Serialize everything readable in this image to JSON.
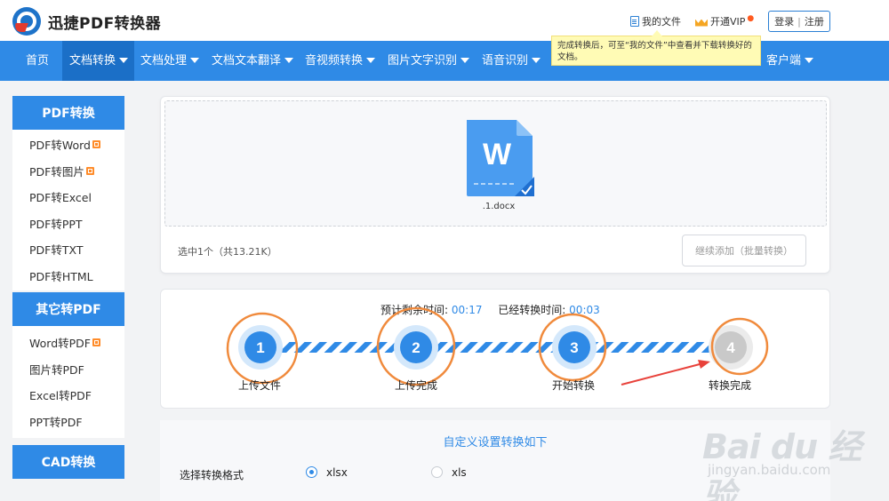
{
  "header": {
    "app_title": "迅捷PDF转换器",
    "my_files": "我的文件",
    "vip": "开通VIP",
    "login": "登录",
    "separator": "|",
    "register": "注册"
  },
  "nav": {
    "items": [
      {
        "label": "首页",
        "dropdown": false
      },
      {
        "label": "文档转换",
        "dropdown": true,
        "active": true
      },
      {
        "label": "文档处理",
        "dropdown": true
      },
      {
        "label": "文档文本翻译",
        "dropdown": true
      },
      {
        "label": "音视频转换",
        "dropdown": true
      },
      {
        "label": "图片文字识别",
        "dropdown": true
      },
      {
        "label": "语音识别",
        "dropdown": true
      },
      {
        "label": "客户端",
        "dropdown": true
      }
    ]
  },
  "tooltip": {
    "text": "完成转换后，可至“我的文件”中查看并下载转换好的文档。"
  },
  "sidebar": {
    "sections": [
      {
        "title": "PDF转换",
        "items": [
          {
            "label": "PDF转Word",
            "badge": true
          },
          {
            "label": "PDF转图片",
            "badge": true
          },
          {
            "label": "PDF转Excel",
            "badge": false
          },
          {
            "label": "PDF转PPT",
            "badge": false
          },
          {
            "label": "PDF转TXT",
            "badge": false
          },
          {
            "label": "PDF转HTML",
            "badge": false
          }
        ]
      },
      {
        "title": "其它转PDF",
        "items": [
          {
            "label": "Word转PDF",
            "badge": true
          },
          {
            "label": "图片转PDF",
            "badge": false
          },
          {
            "label": "Excel转PDF",
            "badge": false
          },
          {
            "label": "PPT转PDF",
            "badge": false
          }
        ]
      },
      {
        "title": "CAD转换",
        "items": []
      }
    ]
  },
  "upload": {
    "file_icon_letter": "W",
    "file_name": ".1.docx",
    "selected_info": "选中1个（共13.21K）",
    "continue_button": "继续添加（批量转换）"
  },
  "progress": {
    "remaining_label": "预计剩余时间:",
    "remaining_value": "00:17",
    "elapsed_label": "已经转换时间:",
    "elapsed_value": "00:03",
    "steps": [
      {
        "number": "1",
        "label": "上传文件",
        "done": true
      },
      {
        "number": "2",
        "label": "上传完成",
        "done": true
      },
      {
        "number": "3",
        "label": "开始转换",
        "done": true
      },
      {
        "number": "4",
        "label": "转换完成",
        "done": false
      }
    ]
  },
  "settings": {
    "title": "自定义设置转换如下",
    "format_label": "选择转换格式",
    "options": [
      {
        "label": "xlsx",
        "checked": true
      },
      {
        "label": "xls",
        "checked": false
      }
    ]
  },
  "watermark": {
    "text": "Bai du 经验",
    "sub": "jingyan.baidu.com"
  },
  "colors": {
    "primary": "#2f8ae6",
    "nav_active": "#1b6fc7",
    "annotation_circle": "#f08a3c",
    "annotation_arrow": "#e8423b",
    "badge": "#ff8c2a"
  }
}
